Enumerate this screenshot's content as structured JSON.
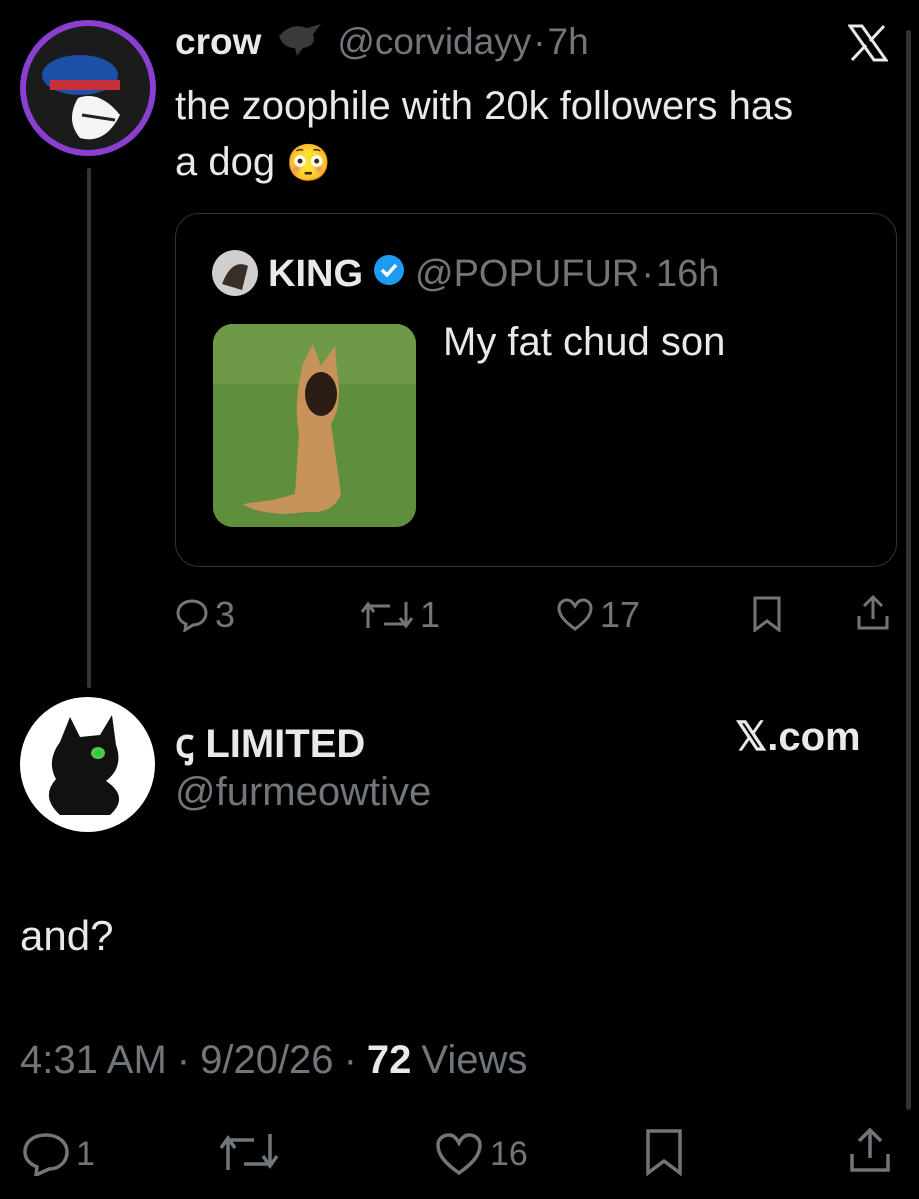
{
  "top_tweet": {
    "name": "crow",
    "handle": "@corvidayy",
    "sep": "·",
    "time": "7h",
    "text_line1": "the zoophile with 20k followers has",
    "text_line2": "a dog",
    "emoji": "😳",
    "x_logo_icon": "x-logo-icon",
    "quote": {
      "name": "KING",
      "handle": "@POPUFUR",
      "sep": "·",
      "time": "16h",
      "text": "My fat chud son",
      "verified_color": "#1d9bf0"
    },
    "actions": {
      "replies": "3",
      "reposts": "1",
      "likes": "17"
    }
  },
  "main_tweet": {
    "name": "ꞔ LIMITED",
    "handle": "@furmeowtive",
    "xcom": "𝕏.com",
    "text": "and?",
    "time": "4:31 AM",
    "date": "9/20/26",
    "sep": "·",
    "views_count": "72",
    "views_label": "Views",
    "actions": {
      "replies": "1",
      "reposts": "",
      "likes": "16"
    }
  },
  "colors": {
    "background": "#000000",
    "text": "#e7e9ea",
    "secondary": "#71767b",
    "border": "#2f3336",
    "avatar_ring": "#8a3fd1"
  }
}
